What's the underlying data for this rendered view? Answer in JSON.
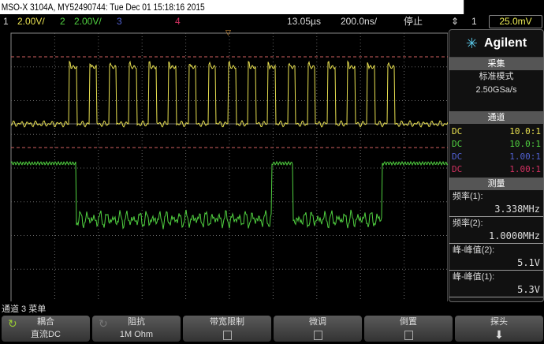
{
  "title": "MSO-X 3104A, MY52490744: Tue Dec 01 15:18:16 2015",
  "topbar": {
    "ch1_num": "1",
    "ch1_scale": "2.00V/",
    "ch2_num": "2",
    "ch2_scale": "2.00V/",
    "ch3_num": "3",
    "ch4_num": "4",
    "delay": "13.05µs",
    "timebase": "200.0ns/",
    "run_state": "停止",
    "trig_icon": "trigger-edge-icon",
    "trig_src": "1",
    "trig_level": "25.0mV"
  },
  "colors": {
    "ch1": "#e8e050",
    "ch2": "#50d040",
    "ch3": "#5060d0",
    "ch4": "#d03060",
    "grid": "#666",
    "marker": "#d06060"
  },
  "side": {
    "brand": "Agilent",
    "acq_header": "采集",
    "acq_mode": "标准模式",
    "acq_rate": "2.50GSa/s",
    "chan_header": "通道",
    "channels": [
      {
        "coupling": "DC",
        "probe": "10.0:1"
      },
      {
        "coupling": "DC",
        "probe": "10.0:1"
      },
      {
        "coupling": "DC",
        "probe": "1.00:1"
      },
      {
        "coupling": "DC",
        "probe": "1.00:1"
      }
    ],
    "meas_header": "测量",
    "measurements": [
      {
        "label": "频率(1):",
        "value": "3.338MHz"
      },
      {
        "label": "频率(2):",
        "value": "1.0000MHz"
      },
      {
        "label": "峰-峰值(2):",
        "value": "5.1V"
      },
      {
        "label": "峰-峰值(1):",
        "value": "5.3V"
      }
    ]
  },
  "menu": {
    "title": "通道 3 菜单",
    "keys": [
      {
        "label": "耦合",
        "value": "直流DC"
      },
      {
        "label": "阻抗",
        "value": "1M Ohm"
      },
      {
        "label": "带宽限制",
        "value": ""
      },
      {
        "label": "微调",
        "value": ""
      },
      {
        "label": "倒置",
        "value": ""
      },
      {
        "label": "探头",
        "value": ""
      }
    ]
  }
}
